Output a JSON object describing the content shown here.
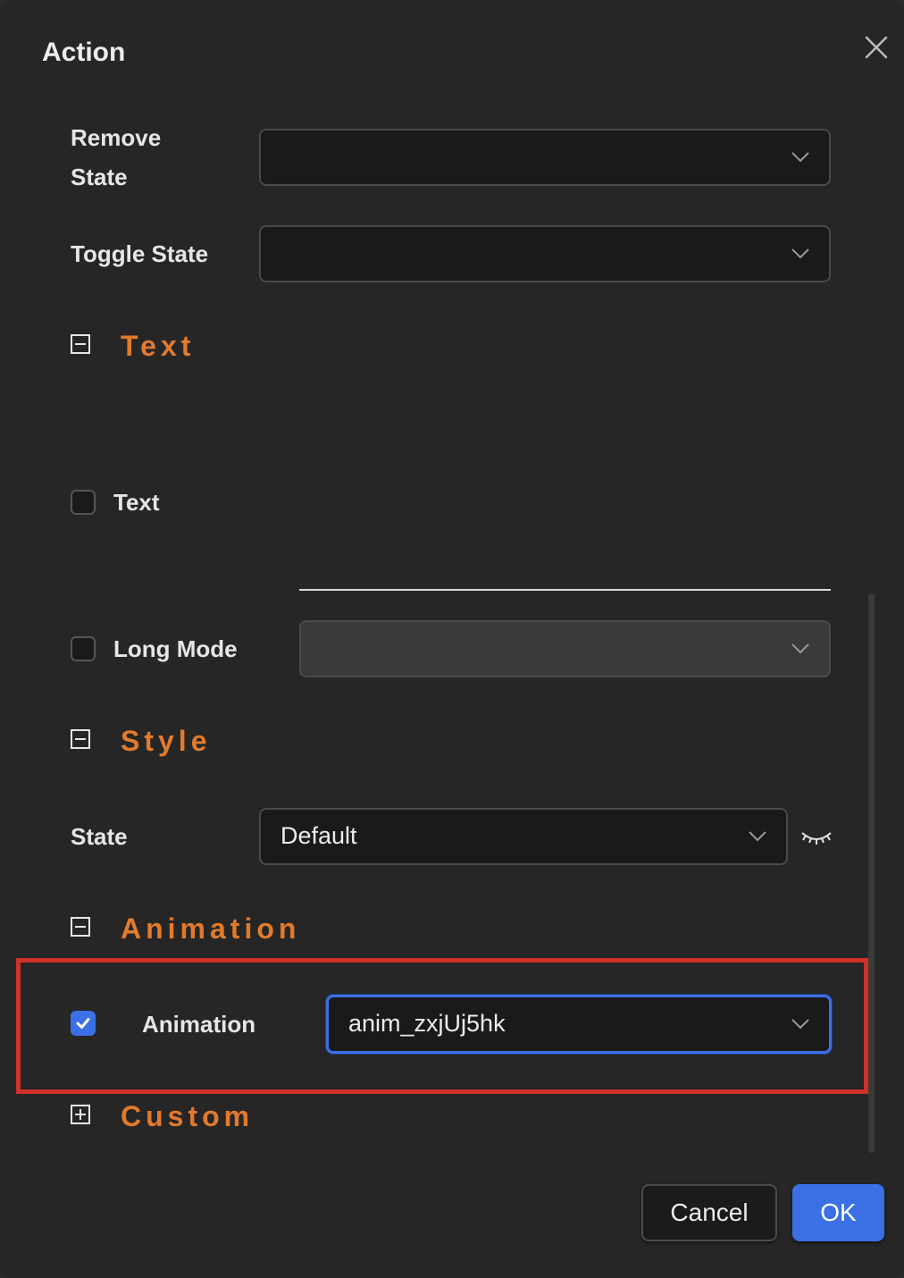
{
  "dialog": {
    "title": "Action"
  },
  "fields": {
    "remove_state": {
      "label_line1": "Remove",
      "label_line2": "State",
      "value": ""
    },
    "toggle_state": {
      "label": "Toggle State",
      "value": ""
    }
  },
  "sections": {
    "text": {
      "title": "Text",
      "expanded": true,
      "text_checkbox_label": "Text",
      "text_checked": false,
      "long_mode_label": "Long Mode",
      "long_mode_checked": false,
      "long_mode_value": ""
    },
    "style": {
      "title": "Style",
      "expanded": true,
      "state_label": "State",
      "state_value": "Default"
    },
    "animation": {
      "title": "Animation",
      "expanded": true,
      "animation_label": "Animation",
      "animation_checked": true,
      "animation_value": "anim_zxjUj5hk"
    },
    "custom": {
      "title": "Custom",
      "expanded": false
    }
  },
  "buttons": {
    "cancel": "Cancel",
    "ok": "OK"
  },
  "colors": {
    "accent": "#3d6fe6",
    "section_title": "#e27a2c",
    "highlight": "#d0312a"
  },
  "icons": {
    "close": "close-icon",
    "chevron": "chevron-down-icon",
    "collapse": "minus-square-icon",
    "expand": "plus-square-icon",
    "visibility": "eye-closed-icon",
    "check": "check-icon"
  }
}
